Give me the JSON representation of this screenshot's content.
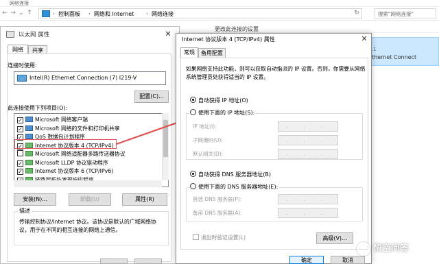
{
  "background_window": {
    "title": "网络连接",
    "breadcrumb": [
      "控制面板",
      "网络和 Internet",
      "网络连接"
    ],
    "search_placeholder": "搜索\"网络连接\"",
    "command_item": "更改此连接的设置",
    "adapter_line1": "…1",
    "adapter_line2": "Ethernet Connect"
  },
  "ethernet_dialog": {
    "title": "以太网 属性",
    "tabs": [
      "网络",
      "共享"
    ],
    "connect_using_label": "连接时使用:",
    "adapter_name": "Intel(R) Ethernet Connection (7) I219-V",
    "configure_button": "配置(C)...",
    "items_label": "此连接使用下列项目(O):",
    "items": [
      {
        "label": "Microsoft 网络客户端",
        "checked": true
      },
      {
        "label": "Microsoft 网络的文件和打印机共享",
        "checked": true
      },
      {
        "label": "QoS 数据包计划程序",
        "checked": true
      },
      {
        "label": "Internet 协议版本 4 (TCP/IPv4)",
        "checked": true
      },
      {
        "label": "Microsoft 网络适配器多路传送器协议",
        "checked": false
      },
      {
        "label": "Microsoft LLDP 协议驱动程序",
        "checked": true
      },
      {
        "label": "Internet 协议版本 6 (TCP/IPv6)",
        "checked": true
      },
      {
        "label": "链路层拓扑发现响应程序",
        "checked": true
      }
    ],
    "install_button": "安装(N)...",
    "uninstall_button": "卸载(U)",
    "properties_button": "属性(R)",
    "description_title": "描述",
    "description_text": "传输控制协议/Internet 协议。该协议是默认的广域网络协议，用于在不同的相互连接的网络上通信。"
  },
  "ipv4_dialog": {
    "title": "Internet 协议版本 4 (TCP/IPv4) 属性",
    "tabs": [
      "常规",
      "备用配置"
    ],
    "intro": "如果网络支持此功能，则可以获取自动指派的 IP 设置。否则，你需要从网络系统管理员处获得适当的 IP 设置。",
    "auto_ip": "自动获得 IP 地址(O)",
    "manual_ip": "使用下面的 IP 地址(S):",
    "ip_label": "IP 地址(I):",
    "subnet_label": "子网掩码(U):",
    "gateway_label": "默认网关(D):",
    "auto_dns": "自动获得 DNS 服务器地址(B)",
    "manual_dns": "使用下面的 DNS 服务器地址(E):",
    "preferred_dns_label": "首选 DNS 服务器(P):",
    "alternate_dns_label": "备用 DNS 服务器(A):",
    "ip_placeholder": ". . .",
    "validate_label": "退出时验证设置(L)",
    "advanced_button": "高级(V)...",
    "ok_button": "确定",
    "cancel_button": "取消"
  },
  "watermark": "悟空问答",
  "colors": {
    "highlight": "#e25a5a",
    "arrow": "#e05050",
    "selected_card": "#cce8ff"
  }
}
